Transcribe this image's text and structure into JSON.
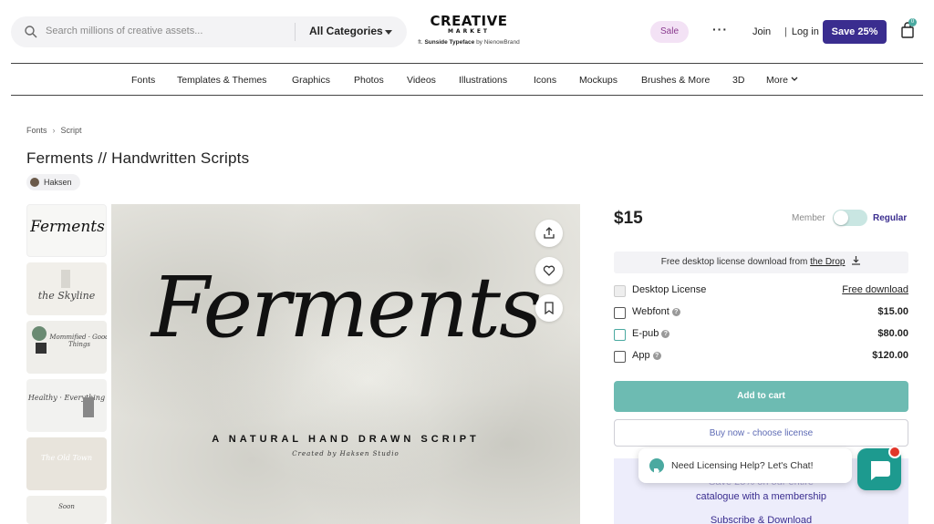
{
  "header": {
    "search_placeholder": "Search millions of creative assets...",
    "category": "All Categories",
    "logo_line1": "CREATIVE",
    "logo_line2": "MARKET",
    "logo_ft": "ft.",
    "logo_typeface": "Sunside Typeface",
    "logo_by": "by NienowBrand",
    "sale": "Sale",
    "more_dots": "···",
    "join": "Join",
    "login_sep": "|",
    "login": "Log in",
    "save": "Save 25%",
    "cart_count": "0"
  },
  "nav": [
    "Fonts",
    "Templates & Themes",
    "Graphics",
    "Photos",
    "Videos",
    "Illustrations",
    "Icons",
    "Mockups",
    "Brushes & More",
    "3D",
    "More"
  ],
  "breadcrumb": [
    "Fonts",
    "Script"
  ],
  "product": {
    "title": "Ferments // Handwritten Scripts",
    "author": "Haksen",
    "hero_script": "Ferments",
    "hero_subtitle": "A NATURAL HAND DRAWN SCRIPT",
    "hero_credit": "Created by Haksen Studio",
    "thumbs": [
      "Ferments",
      "the Skyline",
      "Mommified · Good Things",
      "Healthy · Everything",
      "The Old Town",
      "Soon"
    ]
  },
  "purchase": {
    "price": "$15",
    "member_label": "Member",
    "regular_label": "Regular",
    "drop_text": "Free desktop license download from",
    "drop_link": "the Drop",
    "licenses": [
      {
        "name": "Desktop License",
        "price": "Free download",
        "help": false
      },
      {
        "name": "Webfont",
        "price": "$15.00",
        "help": true
      },
      {
        "name": "E-pub",
        "price": "$80.00",
        "help": true
      },
      {
        "name": "App",
        "price": "$120.00",
        "help": true
      }
    ],
    "add_to_cart": "Add to cart",
    "buy_now": "Buy now - choose license",
    "promo_line1": "Save 25% on our entire",
    "promo_line2": "catalogue with a membership",
    "promo_link": "Subscribe & Download"
  },
  "chat": {
    "prompt": "Need Licensing Help? Let's Chat!"
  },
  "colors": {
    "brand_purple": "#3a2d8f",
    "teal": "#6dbbb2",
    "sale_bg": "#f3e2f5",
    "notification_red": "#e2362a"
  }
}
